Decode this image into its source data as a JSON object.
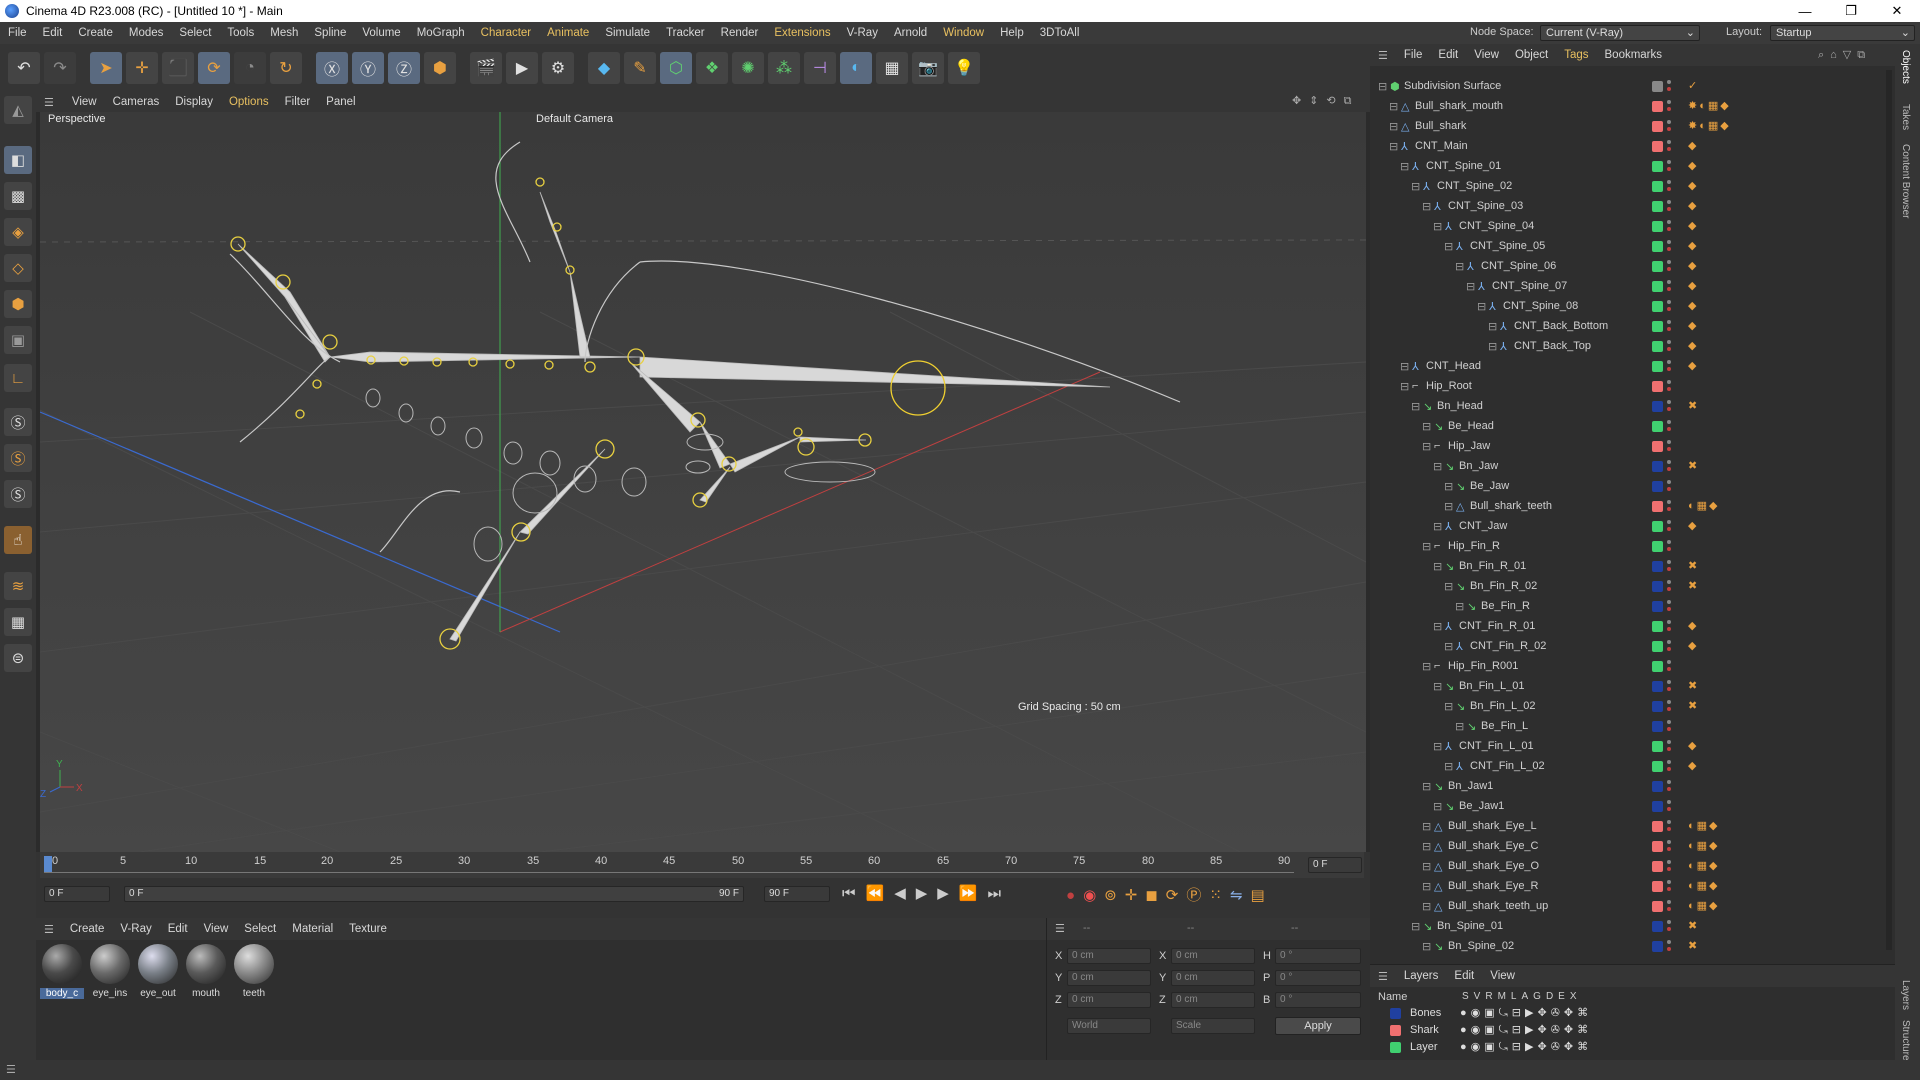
{
  "window": {
    "title": "Cinema 4D R23.008 (RC) - [Untitled 10 *] - Main",
    "minimize": "—",
    "maximize": "❐",
    "close": "✕"
  },
  "menu": [
    "File",
    "Edit",
    "Create",
    "Modes",
    "Select",
    "Tools",
    "Mesh",
    "Spline",
    "Volume",
    "MoGraph",
    "Character",
    "Animate",
    "Simulate",
    "Tracker",
    "Render",
    "Extensions",
    "V-Ray",
    "Arnold",
    "Window",
    "Help",
    "3DToAll"
  ],
  "node_space": {
    "label": "Node Space:",
    "value": "Current (V-Ray)"
  },
  "layout": {
    "label": "Layout:",
    "value": "Startup"
  },
  "viewport_menu": [
    "View",
    "Cameras",
    "Display",
    "Options",
    "Filter",
    "Panel"
  ],
  "viewport": {
    "name": "Perspective",
    "camera": "Default Camera",
    "grid": "Grid Spacing : 50 cm"
  },
  "timeline": {
    "ticks": [
      "0",
      "5",
      "10",
      "15",
      "20",
      "25",
      "30",
      "35",
      "40",
      "45",
      "50",
      "55",
      "60",
      "65",
      "70",
      "75",
      "80",
      "85",
      "90"
    ],
    "current": "0 F",
    "start": "0 F",
    "range_start": "0 F",
    "range_end": "90 F",
    "end": "90 F",
    "right_frame": "0 F"
  },
  "material_menu": [
    "Create",
    "V-Ray",
    "Edit",
    "View",
    "Select",
    "Material",
    "Texture"
  ],
  "materials": [
    {
      "name": "body_c",
      "color": "#4a4a4a"
    },
    {
      "name": "eye_ins",
      "color": "#6a6a6a"
    },
    {
      "name": "eye_out",
      "color": "#7a8088"
    },
    {
      "name": "mouth",
      "color": "#5a5a5a"
    },
    {
      "name": "teeth",
      "color": "#8a8a8a"
    }
  ],
  "coords": {
    "rows": [
      {
        "axis": "X",
        "pos": "0 cm",
        "size_axis": "X",
        "size": "0 cm",
        "rot_axis": "H",
        "rot": "0 °"
      },
      {
        "axis": "Y",
        "pos": "0 cm",
        "size_axis": "Y",
        "size": "0 cm",
        "rot_axis": "P",
        "rot": "0 °"
      },
      {
        "axis": "Z",
        "pos": "0 cm",
        "size_axis": "Z",
        "size": "0 cm",
        "rot_axis": "B",
        "rot": "0 °"
      }
    ],
    "mode": "World",
    "scale": "Scale",
    "apply": "Apply",
    "dashes": "--"
  },
  "objects_menu": [
    "File",
    "Edit",
    "View",
    "Object",
    "Tags",
    "Bookmarks"
  ],
  "objects": [
    {
      "name": "Subdivision Surface",
      "level": 0,
      "color": "#888888",
      "tags": "✓",
      "icon": "subdiv"
    },
    {
      "name": "Bull_shark_mouth",
      "level": 1,
      "color": "#f07070",
      "tags": "✸◐▦◆",
      "icon": "mesh"
    },
    {
      "name": "Bull_shark",
      "level": 1,
      "color": "#f07070",
      "tags": "✸◐▦◆",
      "icon": "mesh"
    },
    {
      "name": "CNT_Main",
      "level": 1,
      "color": "#f07070",
      "tags": "◆",
      "icon": "null"
    },
    {
      "name": "CNT_Spine_01",
      "level": 2,
      "color": "#40d070",
      "tags": "◆",
      "icon": "null"
    },
    {
      "name": "CNT_Spine_02",
      "level": 3,
      "color": "#40d070",
      "tags": "◆",
      "icon": "null"
    },
    {
      "name": "CNT_Spine_03",
      "level": 4,
      "color": "#40d070",
      "tags": "◆",
      "icon": "null"
    },
    {
      "name": "CNT_Spine_04",
      "level": 5,
      "color": "#40d070",
      "tags": "◆",
      "icon": "null"
    },
    {
      "name": "CNT_Spine_05",
      "level": 6,
      "color": "#40d070",
      "tags": "◆",
      "icon": "null"
    },
    {
      "name": "CNT_Spine_06",
      "level": 7,
      "color": "#40d070",
      "tags": "◆",
      "icon": "null"
    },
    {
      "name": "CNT_Spine_07",
      "level": 8,
      "color": "#40d070",
      "tags": "◆",
      "icon": "null"
    },
    {
      "name": "CNT_Spine_08",
      "level": 9,
      "color": "#40d070",
      "tags": "◆",
      "icon": "null"
    },
    {
      "name": "CNT_Back_Bottom",
      "level": 10,
      "color": "#40d070",
      "tags": "◆",
      "icon": "null"
    },
    {
      "name": "CNT_Back_Top",
      "level": 10,
      "color": "#40d070",
      "tags": "◆",
      "icon": "null"
    },
    {
      "name": "CNT_Head",
      "level": 2,
      "color": "#40d070",
      "tags": "◆",
      "icon": "null"
    },
    {
      "name": "Hip_Root",
      "level": 2,
      "color": "#f07070",
      "tags": "",
      "icon": "joint"
    },
    {
      "name": "Bn_Head",
      "level": 3,
      "color": "#2040a0",
      "tags": "✖",
      "icon": "bone"
    },
    {
      "name": "Be_Head",
      "level": 4,
      "color": "#40d070",
      "tags": "",
      "icon": "bone"
    },
    {
      "name": "Hip_Jaw",
      "level": 4,
      "color": "#f07070",
      "tags": "",
      "icon": "joint"
    },
    {
      "name": "Bn_Jaw",
      "level": 5,
      "color": "#2040a0",
      "tags": "✖",
      "icon": "bone"
    },
    {
      "name": "Be_Jaw",
      "level": 6,
      "color": "#2040a0",
      "tags": "",
      "icon": "bone"
    },
    {
      "name": "Bull_shark_teeth",
      "level": 6,
      "color": "#f07070",
      "tags": "◐▦◆",
      "icon": "mesh"
    },
    {
      "name": "CNT_Jaw",
      "level": 5,
      "color": "#40d070",
      "tags": "◆",
      "icon": "null"
    },
    {
      "name": "Hip_Fin_R",
      "level": 4,
      "color": "#40d070",
      "tags": "",
      "icon": "joint"
    },
    {
      "name": "Bn_Fin_R_01",
      "level": 5,
      "color": "#2040a0",
      "tags": "✖",
      "icon": "bone"
    },
    {
      "name": "Bn_Fin_R_02",
      "level": 6,
      "color": "#2040a0",
      "tags": "✖",
      "icon": "bone"
    },
    {
      "name": "Be_Fin_R",
      "level": 7,
      "color": "#2040a0",
      "tags": "",
      "icon": "bone"
    },
    {
      "name": "CNT_Fin_R_01",
      "level": 5,
      "color": "#40d070",
      "tags": "◆",
      "icon": "null"
    },
    {
      "name": "CNT_Fin_R_02",
      "level": 6,
      "color": "#40d070",
      "tags": "◆",
      "icon": "null"
    },
    {
      "name": "Hip_Fin_R001",
      "level": 4,
      "color": "#40d070",
      "tags": "",
      "icon": "joint"
    },
    {
      "name": "Bn_Fin_L_01",
      "level": 5,
      "color": "#2040a0",
      "tags": "✖",
      "icon": "bone"
    },
    {
      "name": "Bn_Fin_L_02",
      "level": 6,
      "color": "#2040a0",
      "tags": "✖",
      "icon": "bone"
    },
    {
      "name": "Be_Fin_L",
      "level": 7,
      "color": "#2040a0",
      "tags": "",
      "icon": "bone"
    },
    {
      "name": "CNT_Fin_L_01",
      "level": 5,
      "color": "#40d070",
      "tags": "◆",
      "icon": "null"
    },
    {
      "name": "CNT_Fin_L_02",
      "level": 6,
      "color": "#40d070",
      "tags": "◆",
      "icon": "null"
    },
    {
      "name": "Bn_Jaw1",
      "level": 4,
      "color": "#2040a0",
      "tags": "",
      "icon": "bone"
    },
    {
      "name": "Be_Jaw1",
      "level": 5,
      "color": "#2040a0",
      "tags": "",
      "icon": "bone"
    },
    {
      "name": "Bull_shark_Eye_L",
      "level": 4,
      "color": "#f07070",
      "tags": "◐▦◆",
      "icon": "mesh"
    },
    {
      "name": "Bull_shark_Eye_C",
      "level": 4,
      "color": "#f07070",
      "tags": "◐▦◆",
      "icon": "mesh"
    },
    {
      "name": "Bull_shark_Eye_O",
      "level": 4,
      "color": "#f07070",
      "tags": "◐▦◆",
      "icon": "mesh"
    },
    {
      "name": "Bull_shark_Eye_R",
      "level": 4,
      "color": "#f07070",
      "tags": "◐▦◆",
      "icon": "mesh"
    },
    {
      "name": "Bull_shark_teeth_up",
      "level": 4,
      "color": "#f07070",
      "tags": "◐▦◆",
      "icon": "mesh"
    },
    {
      "name": "Bn_Spine_01",
      "level": 3,
      "color": "#2040a0",
      "tags": "✖",
      "icon": "bone"
    },
    {
      "name": "Bn_Spine_02",
      "level": 4,
      "color": "#2040a0",
      "tags": "✖",
      "icon": "bone"
    }
  ],
  "layers_menu": [
    "Layers",
    "Edit",
    "View"
  ],
  "layer_columns": {
    "name": "Name",
    "flags": [
      "S",
      "V",
      "R",
      "M",
      "L",
      "A",
      "G",
      "D",
      "E",
      "X"
    ]
  },
  "layers": [
    {
      "name": "Bones",
      "color": "#2040a0"
    },
    {
      "name": "Shark",
      "color": "#f07070"
    },
    {
      "name": "Layer",
      "color": "#40d070"
    }
  ],
  "right_tabs": [
    "Objects",
    "Takes",
    "Content Browser",
    "Layers",
    "Structure"
  ],
  "axis_labels": {
    "y": "Y",
    "z": "Z",
    "x": "X"
  }
}
